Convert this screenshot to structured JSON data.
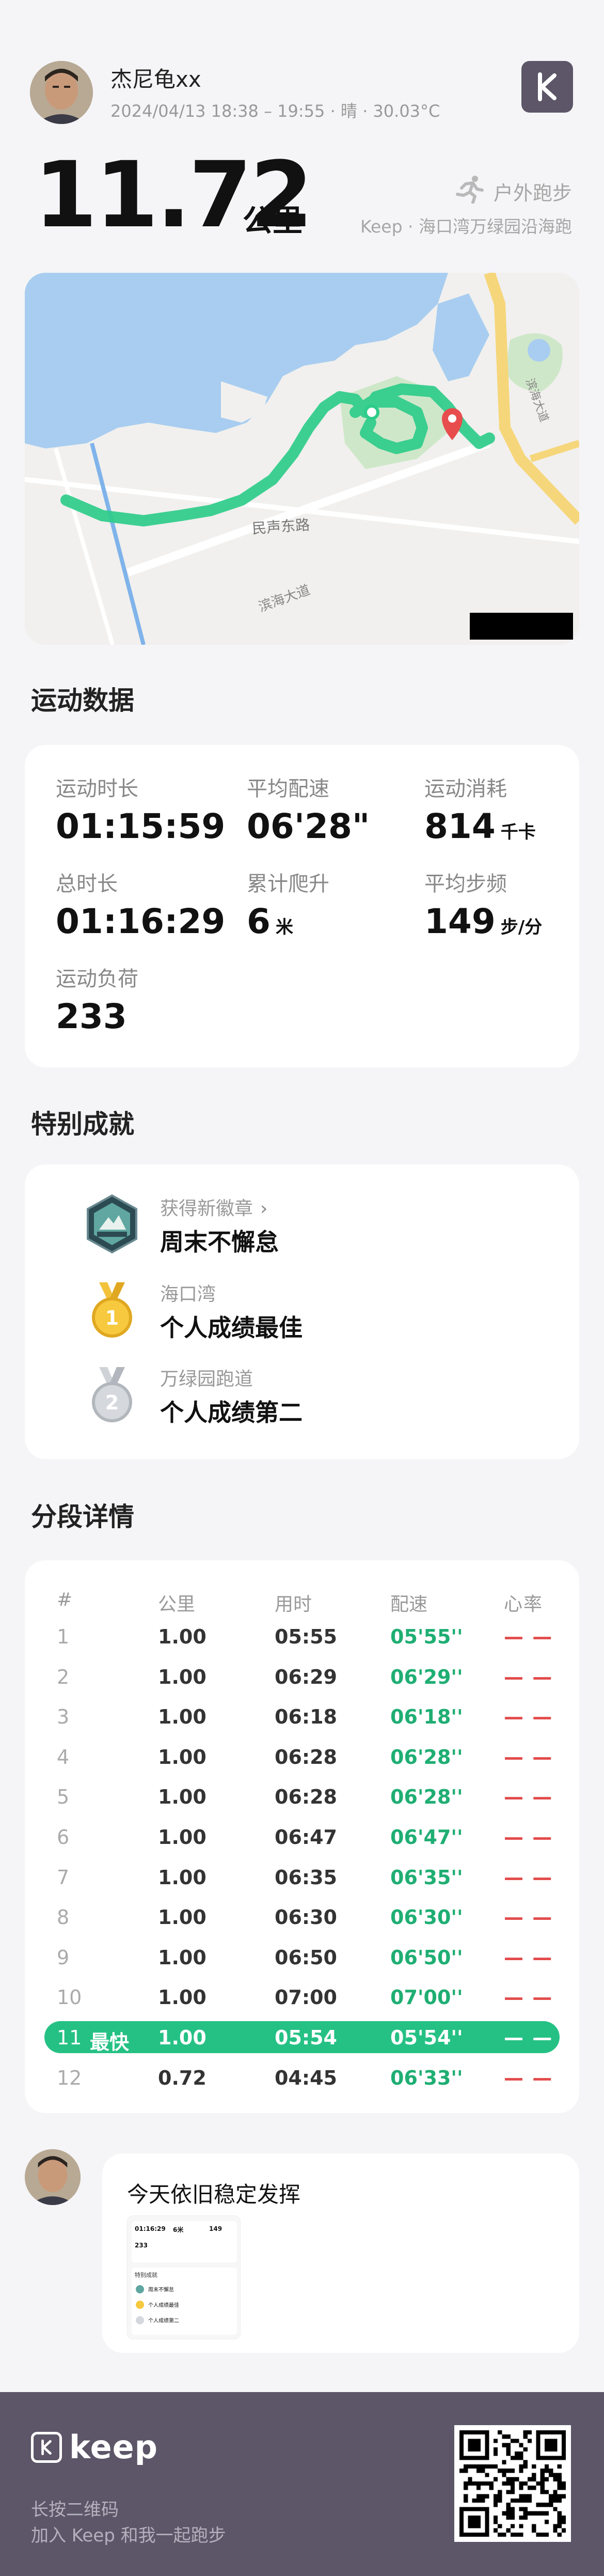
{
  "header": {
    "user_name": "杰尼龟xx",
    "meta": "2024/04/13 18:38 – 19:55 · 晴 · 30.03°C",
    "distance": "11.72",
    "distance_unit": "公里",
    "sport_type": "户外跑步",
    "route": "Keep · 海口湾万绿园沿海跑"
  },
  "map": {
    "labels": [
      "民声东路",
      "滨海大道",
      "滨海大道"
    ],
    "route_color": "#2ecc8a"
  },
  "stats": {
    "title": "运动数据",
    "items": [
      {
        "label": "运动时长",
        "value": "01:15:59",
        "unit": ""
      },
      {
        "label": "平均配速",
        "value": "06'28\"",
        "unit": ""
      },
      {
        "label": "运动消耗",
        "value": "814",
        "unit": "千卡"
      },
      {
        "label": "总时长",
        "value": "01:16:29",
        "unit": ""
      },
      {
        "label": "累计爬升",
        "value": "6",
        "unit": "米"
      },
      {
        "label": "平均步频",
        "value": "149",
        "unit": "步/分"
      },
      {
        "label": "运动负荷",
        "value": "233",
        "unit": ""
      }
    ]
  },
  "achievements": {
    "title": "特别成就",
    "items": [
      {
        "small": "获得新徽章",
        "big": "周末不懈怠",
        "icon": "badge-icon"
      },
      {
        "small": "海口湾",
        "big": "个人成绩最佳",
        "icon": "gold-medal-icon"
      },
      {
        "small": "万绿园跑道",
        "big": "个人成绩第二",
        "icon": "silver-medal-icon"
      }
    ]
  },
  "splits": {
    "title": "分段详情",
    "headers": {
      "idx": "#",
      "km": "公里",
      "time": "用时",
      "pace": "配速",
      "hr": "心率"
    },
    "rows": [
      {
        "idx": "1",
        "km": "1.00",
        "time": "05:55",
        "pace": "05'55''",
        "hr": "— —"
      },
      {
        "idx": "2",
        "km": "1.00",
        "time": "06:29",
        "pace": "06'29''",
        "hr": "— —"
      },
      {
        "idx": "3",
        "km": "1.00",
        "time": "06:18",
        "pace": "06'18''",
        "hr": "— —"
      },
      {
        "idx": "4",
        "km": "1.00",
        "time": "06:28",
        "pace": "06'28''",
        "hr": "— —"
      },
      {
        "idx": "5",
        "km": "1.00",
        "time": "06:28",
        "pace": "06'28''",
        "hr": "— —"
      },
      {
        "idx": "6",
        "km": "1.00",
        "time": "06:47",
        "pace": "06'47''",
        "hr": "— —"
      },
      {
        "idx": "7",
        "km": "1.00",
        "time": "06:35",
        "pace": "06'35''",
        "hr": "— —"
      },
      {
        "idx": "8",
        "km": "1.00",
        "time": "06:30",
        "pace": "06'30''",
        "hr": "— —"
      },
      {
        "idx": "9",
        "km": "1.00",
        "time": "06:50",
        "pace": "06'50''",
        "hr": "— —"
      },
      {
        "idx": "10",
        "km": "1.00",
        "time": "07:00",
        "pace": "07'00''",
        "hr": "— —"
      },
      {
        "idx": "11",
        "km": "1.00",
        "time": "05:54",
        "pace": "05'54''",
        "hr": "— —"
      },
      {
        "idx": "12",
        "km": "0.72",
        "time": "04:45",
        "pace": "06'33''",
        "hr": "— —"
      }
    ],
    "fastest_tag": "最快",
    "colors": {
      "pace": "#1fae73",
      "hr": "#e34b4b",
      "highlight": "#25c184"
    }
  },
  "comment": {
    "text": "今天依旧稳定发挥",
    "mini": {
      "time": "01:16:29",
      "climb": "6米",
      "cadence": "149",
      "load": "233",
      "section": "特别成就",
      "a1": "周末不懈怠",
      "a2": "个人成绩最佳",
      "a3": "个人成绩第二"
    }
  },
  "footer": {
    "brand": "keep",
    "line1": "长按二维码",
    "line2": "加入 Keep 和我一起跑步",
    "bg_color": "#5c5668"
  }
}
